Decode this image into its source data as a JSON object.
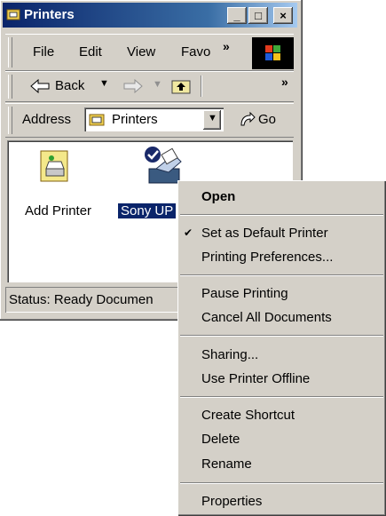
{
  "window": {
    "title": "Printers",
    "minimize_glyph": "_",
    "maximize_glyph": "□",
    "close_glyph": "×"
  },
  "menubar": {
    "items": [
      "File",
      "Edit",
      "View",
      "Favo"
    ],
    "overflow_glyph": "»"
  },
  "toolbar": {
    "back_label": "Back",
    "overflow_glyph": "»"
  },
  "addressbar": {
    "label": "Address",
    "value": "Printers",
    "go_label": "Go"
  },
  "content": {
    "items": [
      {
        "label": "Add Printer",
        "selected": false
      },
      {
        "label": "Sony UP",
        "selected": true
      }
    ]
  },
  "status": {
    "text": "Status: Ready Documen"
  },
  "context_menu": {
    "items": [
      {
        "label": "Open",
        "bold": true
      },
      {
        "label": "Set as Default Printer",
        "checked": true
      },
      {
        "label": "Printing Preferences..."
      },
      {
        "label": "Pause Printing"
      },
      {
        "label": "Cancel All Documents"
      },
      {
        "label": "Sharing..."
      },
      {
        "label": "Use Printer Offline"
      },
      {
        "label": "Create Shortcut"
      },
      {
        "label": "Delete"
      },
      {
        "label": "Rename"
      },
      {
        "label": "Properties"
      }
    ],
    "check_glyph": "✔"
  },
  "colors": {
    "titlebar_start": "#0a246a",
    "titlebar_end": "#a6caf0",
    "face": "#d4d0c8",
    "selection": "#0a246a"
  }
}
